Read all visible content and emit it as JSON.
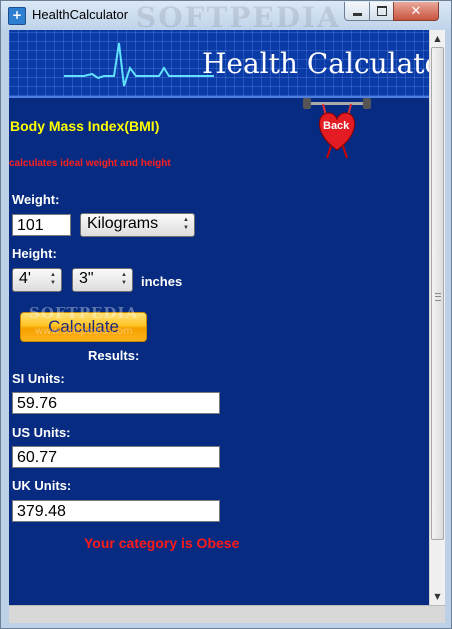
{
  "window": {
    "title": "HealthCalculator",
    "watermark": "SOFTPEDIA"
  },
  "banner": {
    "title": "Health Calculator"
  },
  "section": {
    "heading": "Body Mass Index(BMI)",
    "subheading": "calculates ideal weight and height"
  },
  "back_button": {
    "label": "Back"
  },
  "form": {
    "weight_label": "Weight:",
    "weight_value": "101",
    "weight_unit": "Kilograms",
    "height_label": "Height:",
    "height_feet": "4'",
    "height_inches": "3\"",
    "inches_label": "inches"
  },
  "calculate_button": {
    "label": "Calculate"
  },
  "watermarks": {
    "brand": "SOFTPEDIA",
    "url": "www.softpedia.com"
  },
  "results": {
    "heading": "Results:",
    "si_label": "SI Units:",
    "si_value": "59.76",
    "us_label": "US Units:",
    "us_value": "60.77",
    "uk_label": "UK Units:",
    "uk_value": "379.48",
    "category": "Your category is Obese"
  },
  "colors": {
    "background": "#072b80",
    "accent_yellow": "#ffff00",
    "alert_red": "#ff1a1a",
    "button_orange": "#ffc424"
  }
}
